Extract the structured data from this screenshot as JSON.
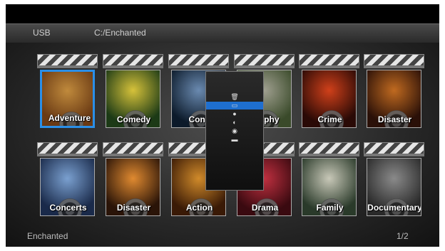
{
  "header": {
    "source": "USB",
    "path": "C:/Enchanted"
  },
  "tiles_row1": [
    {
      "label": "Adventure",
      "colors": [
        "#6a3a14",
        "#c08a3c"
      ]
    },
    {
      "label": "Comedy",
      "colors": [
        "#1c3a16",
        "#d6c23a"
      ]
    },
    {
      "label": "Conc",
      "colors": [
        "#0c1a2a",
        "#6a8ab0"
      ]
    },
    {
      "label": "graphy",
      "colors": [
        "#3a4a2a",
        "#a0a090"
      ]
    },
    {
      "label": "Crime",
      "colors": [
        "#2a0a06",
        "#d0401a"
      ]
    },
    {
      "label": "Disaster",
      "colors": [
        "#2a1008",
        "#c06a20"
      ]
    }
  ],
  "tiles_row2": [
    {
      "label": "Concerts",
      "colors": [
        "#1a2a4a",
        "#7aa0d0"
      ]
    },
    {
      "label": "Disaster",
      "colors": [
        "#2a1408",
        "#e08a30"
      ]
    },
    {
      "label": "Action",
      "colors": [
        "#3a1a06",
        "#d08a2a"
      ]
    },
    {
      "label": "Drama",
      "colors": [
        "#3a0a10",
        "#c03040"
      ]
    },
    {
      "label": "Family",
      "colors": [
        "#2a3a2a",
        "#c8c8b8"
      ]
    },
    {
      "label": "Documentary",
      "colors": [
        "#2a2a2a",
        "#8a8a8a"
      ]
    }
  ],
  "popup": {
    "items": [
      {
        "icon": "trash-icon",
        "glyph": "🗑",
        "active": false
      },
      {
        "icon": "rename-icon",
        "glyph": "▭",
        "active": true
      },
      {
        "icon": "info-icon",
        "glyph": "●",
        "active": false
      },
      {
        "icon": "copy-icon",
        "glyph": "◐",
        "active": false
      },
      {
        "icon": "settings-icon",
        "glyph": "◉",
        "active": false
      },
      {
        "icon": "folder-icon",
        "glyph": "▬",
        "active": false
      }
    ]
  },
  "footer": {
    "folder": "Enchanted",
    "page": "1/2"
  },
  "accent": "#2a8fe8"
}
